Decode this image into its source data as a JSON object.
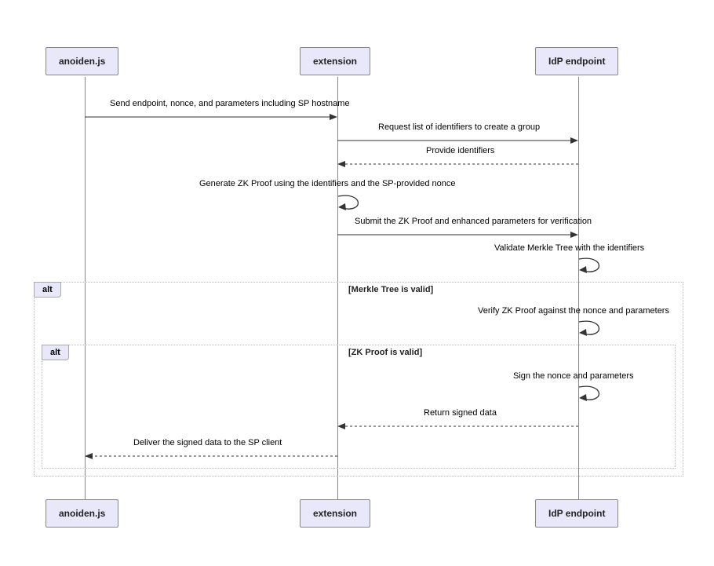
{
  "chart_data": {
    "type": "sequence_diagram",
    "participants": [
      "anoiden.js",
      "extension",
      "IdP endpoint"
    ],
    "messages": [
      {
        "from": "anoiden.js",
        "to": "extension",
        "text": "Send endpoint, nonce, and parameters including SP hostname",
        "style": "solid"
      },
      {
        "from": "extension",
        "to": "IdP endpoint",
        "text": "Request list of identifiers to create a group",
        "style": "solid"
      },
      {
        "from": "IdP endpoint",
        "to": "extension",
        "text": "Provide identifiers",
        "style": "dashed"
      },
      {
        "from": "extension",
        "to": "extension",
        "text": "Generate ZK Proof using the identifiers and the SP-provided nonce",
        "style": "self"
      },
      {
        "from": "extension",
        "to": "IdP endpoint",
        "text": "Submit the ZK Proof and enhanced parameters for verification",
        "style": "solid"
      },
      {
        "from": "IdP endpoint",
        "to": "IdP endpoint",
        "text": "Validate Merkle Tree with the identifiers",
        "style": "self"
      },
      {
        "from": "IdP endpoint",
        "to": "IdP endpoint",
        "text": "Verify ZK Proof against the nonce and parameters",
        "style": "self",
        "alt_group": "outer"
      },
      {
        "from": "IdP endpoint",
        "to": "IdP endpoint",
        "text": "Sign the nonce and parameters",
        "style": "self",
        "alt_group": "inner"
      },
      {
        "from": "IdP endpoint",
        "to": "extension",
        "text": "Return signed data",
        "style": "dashed",
        "alt_group": "inner"
      },
      {
        "from": "extension",
        "to": "anoiden.js",
        "text": "Deliver the signed data to the SP client",
        "style": "dashed",
        "alt_group": "inner"
      }
    ],
    "alt_blocks": [
      {
        "label": "alt",
        "condition": "[Merkle Tree is valid]",
        "id": "outer"
      },
      {
        "label": "alt",
        "condition": "[ZK Proof is valid]",
        "id": "inner"
      }
    ]
  },
  "participants": {
    "p1": "anoiden.js",
    "p2": "extension",
    "p3": "IdP endpoint"
  },
  "messages": {
    "m1": "Send endpoint, nonce, and parameters including SP hostname",
    "m2": "Request list of identifiers to create a group",
    "m3": "Provide identifiers",
    "m4": "Generate ZK Proof using the identifiers and the SP-provided nonce",
    "m5": "Submit the ZK Proof and enhanced parameters for verification",
    "m6": "Validate Merkle Tree with the identifiers",
    "m7": "Verify ZK Proof against the nonce and parameters",
    "m8": "Sign the nonce and parameters",
    "m9": "Return signed data",
    "m10": "Deliver the signed data to the SP client"
  },
  "alt": {
    "label1": "alt",
    "cond1": "[Merkle Tree is valid]",
    "label2": "alt",
    "cond2": "[ZK Proof is valid]"
  }
}
